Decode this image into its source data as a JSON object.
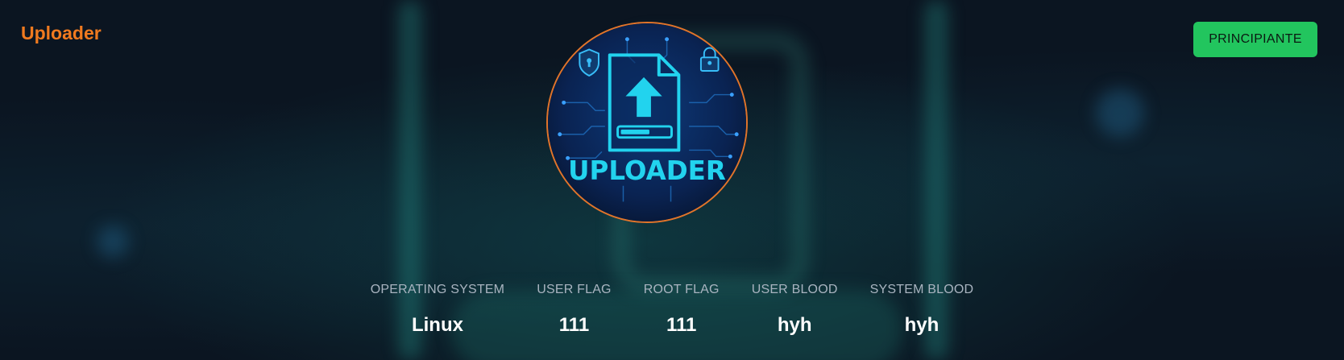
{
  "machine": {
    "name": "Uploader",
    "difficulty": "PRINCIPIANTE",
    "logo_text": "UPLOADER"
  },
  "stats": [
    {
      "label": "OPERATING SYSTEM",
      "value": "Linux"
    },
    {
      "label": "USER FLAG",
      "value": "111"
    },
    {
      "label": "ROOT FLAG",
      "value": "111"
    },
    {
      "label": "USER BLOOD",
      "value": "hyh"
    },
    {
      "label": "SYSTEM BLOOD",
      "value": "hyh"
    }
  ],
  "colors": {
    "title": "#f07a1f",
    "badge_bg": "#22c55e",
    "logo_border": "#e2742a",
    "logo_accent": "#22d3ee",
    "background": "#0b1521"
  },
  "icons": {
    "logo_main": "file-upload-icon",
    "logo_left": "shield-lock-icon",
    "logo_right": "padlock-icon"
  }
}
